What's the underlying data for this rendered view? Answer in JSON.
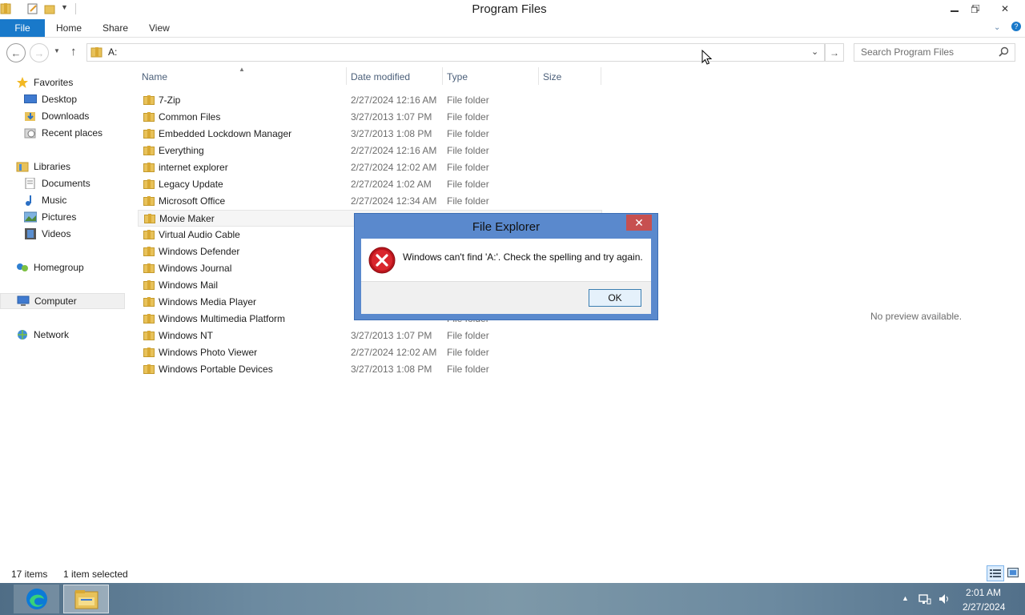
{
  "window": {
    "title": "Program Files"
  },
  "ribbon": {
    "tabs": [
      "File",
      "Home",
      "Share",
      "View"
    ]
  },
  "address": {
    "path": "A:"
  },
  "search": {
    "placeholder": "Search Program Files"
  },
  "nav": {
    "favorites": "Favorites",
    "favorites_items": [
      "Desktop",
      "Downloads",
      "Recent places"
    ],
    "libraries": "Libraries",
    "libraries_items": [
      "Documents",
      "Music",
      "Pictures",
      "Videos"
    ],
    "homegroup": "Homegroup",
    "computer": "Computer",
    "network": "Network"
  },
  "columns": {
    "name": "Name",
    "date": "Date modified",
    "type": "Type",
    "size": "Size"
  },
  "files": [
    {
      "name": "7-Zip",
      "date": "2/27/2024 12:16 AM",
      "type": "File folder"
    },
    {
      "name": "Common Files",
      "date": "3/27/2013 1:07 PM",
      "type": "File folder"
    },
    {
      "name": "Embedded Lockdown Manager",
      "date": "3/27/2013 1:08 PM",
      "type": "File folder"
    },
    {
      "name": "Everything",
      "date": "2/27/2024 12:16 AM",
      "type": "File folder"
    },
    {
      "name": "internet explorer",
      "date": "2/27/2024 12:02 AM",
      "type": "File folder"
    },
    {
      "name": "Legacy Update",
      "date": "2/27/2024 1:02 AM",
      "type": "File folder"
    },
    {
      "name": "Microsoft Office",
      "date": "2/27/2024 12:34 AM",
      "type": "File folder"
    },
    {
      "name": "Movie Maker",
      "date": "",
      "type": ""
    },
    {
      "name": "Virtual Audio Cable",
      "date": "",
      "type": ""
    },
    {
      "name": "Windows Defender",
      "date": "",
      "type": ""
    },
    {
      "name": "Windows Journal",
      "date": "",
      "type": ""
    },
    {
      "name": "Windows Mail",
      "date": "",
      "type": ""
    },
    {
      "name": "Windows Media Player",
      "date": "",
      "type": ""
    },
    {
      "name": "Windows Multimedia Platform",
      "date": "",
      "type": "File folder"
    },
    {
      "name": "Windows NT",
      "date": "3/27/2013 1:07 PM",
      "type": "File folder"
    },
    {
      "name": "Windows Photo Viewer",
      "date": "2/27/2024 12:02 AM",
      "type": "File folder"
    },
    {
      "name": "Windows Portable Devices",
      "date": "3/27/2013 1:08 PM",
      "type": "File folder"
    }
  ],
  "preview": {
    "text": "No preview available."
  },
  "status": {
    "items": "17 items",
    "selected": "1 item selected"
  },
  "dialog": {
    "title": "File Explorer",
    "message": "Windows can't find 'A:'. Check the spelling and try again.",
    "ok": "OK"
  },
  "taskbar": {
    "time": "2:01 AM",
    "date": "2/27/2024"
  },
  "icons": [
    "folder-icon",
    "back-arrow-icon",
    "forward-arrow-icon",
    "up-arrow-icon",
    "search-icon",
    "error-icon",
    "close-icon",
    "edge-icon",
    "file-explorer-icon",
    "network-tray-icon",
    "volume-icon",
    "star-icon"
  ],
  "colors": {
    "file_tab": "#1979ca",
    "dialog_frame": "#5a89cd",
    "dialog_close": "#c75050",
    "folder": "#e8c25a"
  }
}
